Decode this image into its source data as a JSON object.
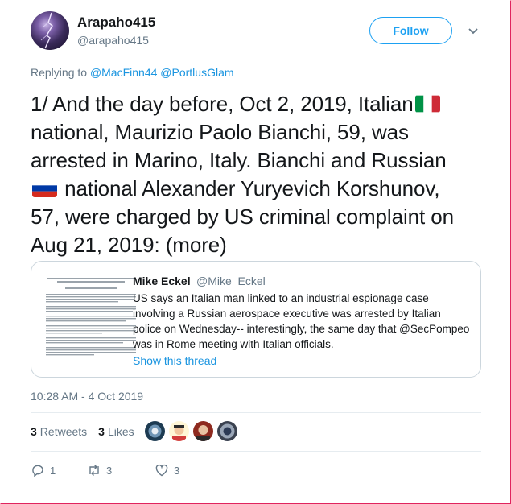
{
  "user": {
    "name": "Arapaho415",
    "handle": "@arapaho415",
    "follow_label": "Follow"
  },
  "reply": {
    "prefix": "Replying to",
    "mention1": "@MacFinn44",
    "mention2": "@PortlusGlam"
  },
  "tweet": {
    "line1_a": "1/ And the day before, Oct 2, 2019, Italian",
    "line2": "national, Maurizio Paolo Bianchi, 59, was",
    "line3": "arrested in Marino, Italy. Bianchi and Russian",
    "line4_b": " national Alexander Yuryevich Korshunov,",
    "line5": "57, were charged by US criminal complaint on",
    "line6": "Aug 21, 2019: (more)"
  },
  "quote": {
    "author": "Mike Eckel",
    "handle": "@Mike_Eckel",
    "body": "US says an Italian man linked to an industrial espionage case involving a Russian aerospace executive was arrested by Italian police on Wednesday-- interestingly, the same day that @SecPompeo was in Rome meeting with Italian officials.",
    "show_thread": "Show this thread"
  },
  "timestamp": "10:28 AM - 4 Oct 2019",
  "stats": {
    "retweets_count": "3",
    "retweets_label": "Retweets",
    "likes_count": "3",
    "likes_label": "Likes"
  },
  "actions": {
    "reply_count": "1",
    "retweet_count": "3",
    "like_count": "3"
  },
  "icons": {
    "more": "chevron-down-icon",
    "reply": "reply-icon",
    "retweet": "retweet-icon",
    "like": "heart-icon"
  },
  "colors": {
    "accent": "#1da1f2",
    "link": "#1b95e0",
    "muted": "#657786",
    "text": "#14171a"
  }
}
